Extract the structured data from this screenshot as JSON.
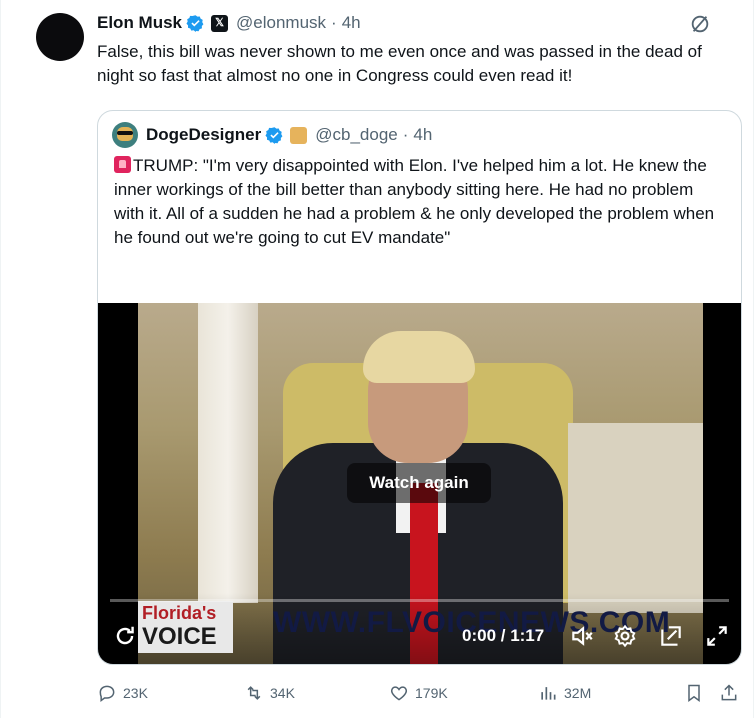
{
  "tweet": {
    "author_name": "Elon Musk",
    "author_handle": "@elonmusk",
    "time": "4h",
    "separator": "·",
    "text": "False, this bill was never shown to me even once and was passed in the dead of night so fast that almost no one in Congress could even read it!"
  },
  "quote": {
    "author_name": "DogeDesigner",
    "author_handle": "@cb_doge",
    "time": "4h",
    "separator": "·",
    "text": "TRUMP: \"I'm very disappointed with Elon. I've helped him a lot. He knew the inner workings of the bill better than anybody sitting here. He had no problem with it. All of a sudden he had a problem & he only developed the problem when he found out we're going to cut EV mandate\"",
    "video": {
      "overlay_button": "Watch again",
      "time_display": "0:00 / 1:17",
      "progress": 0,
      "watermark_line1": "Florida's",
      "watermark_line2": "VOICE",
      "watermark_url": "WWW.FLVOICENEWS.COM"
    }
  },
  "actions": {
    "replies": "23K",
    "reposts": "34K",
    "likes": "179K",
    "views": "32M"
  },
  "colors": {
    "verified": "#1d9bf0",
    "muted": "#536471",
    "border": "#cfd9de",
    "tie": "#c8141e"
  },
  "icons": [
    "grok-icon",
    "verified-icon",
    "x-premium-icon",
    "doge-emoji-icon",
    "siren-emoji-icon",
    "replay-icon",
    "volume-icon",
    "settings-icon",
    "pip-icon",
    "fullscreen-icon",
    "reply-icon",
    "repost-icon",
    "like-icon",
    "views-icon",
    "bookmark-icon",
    "share-icon"
  ]
}
